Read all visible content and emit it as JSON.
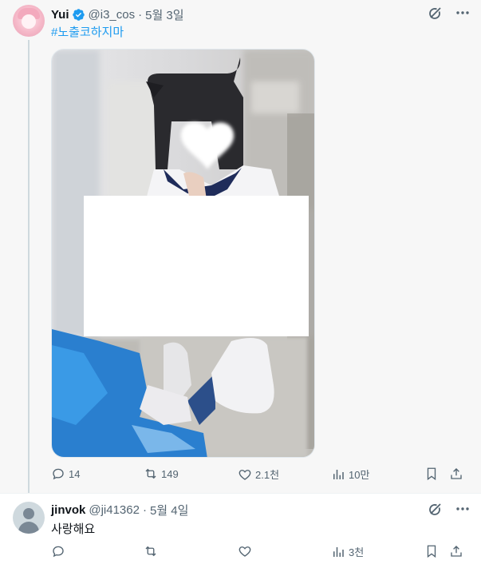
{
  "tweet": {
    "author_name": "Yui",
    "handle": "@i3_cos",
    "separator": "·",
    "time": "5월 3일",
    "hashtag": "#노출코하지마",
    "stats": {
      "replies": "14",
      "retweets": "149",
      "likes": "2.1천",
      "views": "10만"
    }
  },
  "reply": {
    "author_name": "jinvok",
    "handle": "@ji41362",
    "separator": "·",
    "time": "5월 4일",
    "text": "사랑해요",
    "stats": {
      "replies": "",
      "retweets": "",
      "likes": "",
      "views": "3천"
    }
  },
  "icons": {
    "verified": "verified-badge-icon",
    "grok": "grok-icon",
    "more": "more-icon",
    "reply": "reply-icon",
    "retweet": "retweet-icon",
    "like": "heart-icon",
    "views": "views-icon",
    "bookmark": "bookmark-icon",
    "share": "share-icon"
  },
  "colors": {
    "accent": "#1d9bf0",
    "secondary_text": "#536471",
    "primary_text": "#0f1419"
  }
}
